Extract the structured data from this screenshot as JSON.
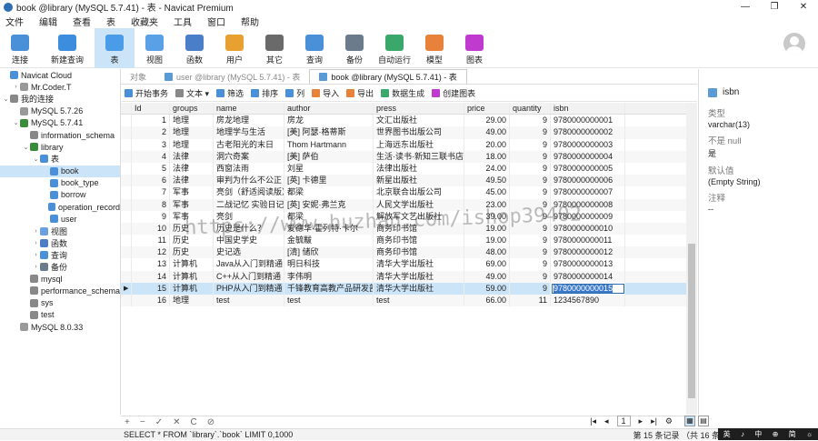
{
  "window": {
    "title": "book @library (MySQL 5.7.41) - 表 - Navicat Premium",
    "controls": [
      "—",
      "❐",
      "✕"
    ]
  },
  "menu": [
    "文件",
    "编辑",
    "查看",
    "表",
    "收藏夹",
    "工具",
    "窗口",
    "帮助"
  ],
  "toolbar": {
    "buttons": [
      {
        "label": "连接",
        "icon": "plug-icon",
        "color": "#4a90d9"
      },
      {
        "label": "新建查询",
        "icon": "query-icon",
        "color": "#3c8dde"
      },
      {
        "label": "表",
        "icon": "table-icon",
        "color": "#4a9be8"
      },
      {
        "label": "视图",
        "icon": "view-icon",
        "color": "#5aa0e6"
      },
      {
        "label": "函数",
        "icon": "function-icon",
        "color": "#4b7ec9"
      },
      {
        "label": "用户",
        "icon": "user-icon",
        "color": "#e8a030"
      },
      {
        "label": "其它",
        "icon": "tools-icon",
        "color": "#6a6a6a"
      },
      {
        "label": "查询",
        "icon": "search-table-icon",
        "color": "#4a90d9"
      },
      {
        "label": "备份",
        "icon": "backup-icon",
        "color": "#6b7b8b"
      },
      {
        "label": "自动运行",
        "icon": "robot-icon",
        "color": "#3aa86b"
      },
      {
        "label": "模型",
        "icon": "model-icon",
        "color": "#e8823a"
      },
      {
        "label": "图表",
        "icon": "chart-icon",
        "color": "#c03ad0"
      }
    ]
  },
  "sidebar": {
    "items": [
      {
        "label": "Navicat Cloud",
        "level": 0,
        "arrow": "",
        "icon": "cloud-icon",
        "color": "#4a90d9"
      },
      {
        "label": "Mr.Coder.T",
        "level": 1,
        "arrow": "›",
        "icon": "cloud-user-icon",
        "color": "#999"
      },
      {
        "label": "我的连接",
        "level": 0,
        "arrow": "⌄",
        "icon": "connections-icon",
        "color": "#888"
      },
      {
        "label": "MySQL 5.7.26",
        "level": 1,
        "arrow": "",
        "icon": "mysql-icon",
        "color": "#999"
      },
      {
        "label": "MySQL 5.7.41",
        "level": 1,
        "arrow": "⌄",
        "icon": "mysql-icon",
        "color": "#3a8b3a"
      },
      {
        "label": "information_schema",
        "level": 2,
        "arrow": "",
        "icon": "database-icon",
        "color": "#888"
      },
      {
        "label": "library",
        "level": 2,
        "arrow": "⌄",
        "icon": "database-icon",
        "color": "#3a8b3a"
      },
      {
        "label": "表",
        "level": 3,
        "arrow": "⌄",
        "icon": "tables-folder-icon",
        "color": "#4a90d9"
      },
      {
        "label": "book",
        "level": 4,
        "arrow": "",
        "icon": "table-icon",
        "color": "#4a90d9",
        "selected": true
      },
      {
        "label": "book_type",
        "level": 4,
        "arrow": "",
        "icon": "table-icon",
        "color": "#4a90d9"
      },
      {
        "label": "borrow",
        "level": 4,
        "arrow": "",
        "icon": "table-icon",
        "color": "#4a90d9"
      },
      {
        "label": "operation_record",
        "level": 4,
        "arrow": "",
        "icon": "table-icon",
        "color": "#4a90d9"
      },
      {
        "label": "user",
        "level": 4,
        "arrow": "",
        "icon": "table-icon",
        "color": "#4a90d9"
      },
      {
        "label": "视图",
        "level": 3,
        "arrow": "›",
        "icon": "views-folder-icon",
        "color": "#6aa0e0"
      },
      {
        "label": "函数",
        "level": 3,
        "arrow": "›",
        "icon": "functions-folder-icon",
        "color": "#4b7ec9"
      },
      {
        "label": "查询",
        "level": 3,
        "arrow": "›",
        "icon": "queries-folder-icon",
        "color": "#4a90d9"
      },
      {
        "label": "备份",
        "level": 3,
        "arrow": "›",
        "icon": "backups-folder-icon",
        "color": "#6b7b8b"
      },
      {
        "label": "mysql",
        "level": 2,
        "arrow": "",
        "icon": "database-icon",
        "color": "#888"
      },
      {
        "label": "performance_schema",
        "level": 2,
        "arrow": "",
        "icon": "database-icon",
        "color": "#888"
      },
      {
        "label": "sys",
        "level": 2,
        "arrow": "",
        "icon": "database-icon",
        "color": "#888"
      },
      {
        "label": "test",
        "level": 2,
        "arrow": "",
        "icon": "database-icon",
        "color": "#888"
      },
      {
        "label": "MySQL 8.0.33",
        "level": 1,
        "arrow": "",
        "icon": "mysql-icon",
        "color": "#999"
      }
    ]
  },
  "tabs": [
    {
      "label": "对象",
      "active": false,
      "icon": false
    },
    {
      "label": "user @library (MySQL 5.7.41) - 表",
      "active": false,
      "icon": true
    },
    {
      "label": "book @library (MySQL 5.7.41) - 表",
      "active": true,
      "icon": true
    }
  ],
  "subtoolbar": [
    {
      "label": "开始事务",
      "icon": "transaction-icon",
      "color": "#4a90d9"
    },
    {
      "label": "文本 ▾",
      "icon": "text-icon",
      "color": "#888"
    },
    {
      "label": "筛选",
      "icon": "filter-icon",
      "color": "#4a90d9"
    },
    {
      "label": "排序",
      "icon": "sort-icon",
      "color": "#4a90d9"
    },
    {
      "label": "列",
      "icon": "columns-icon",
      "color": "#4a90d9"
    },
    {
      "label": "导入",
      "icon": "import-icon",
      "color": "#e8823a"
    },
    {
      "label": "导出",
      "icon": "export-icon",
      "color": "#e8823a"
    },
    {
      "label": "数据生成",
      "icon": "generate-data-icon",
      "color": "#3aa86b"
    },
    {
      "label": "创建图表",
      "icon": "create-chart-icon",
      "color": "#c03ad0"
    }
  ],
  "grid": {
    "columns": [
      "Id",
      "groups",
      "name",
      "author",
      "press",
      "price",
      "quantity",
      "isbn"
    ],
    "rows": [
      [
        "1",
        "地理",
        "房龙地理",
        "房龙",
        "文汇出版社",
        "29.00",
        "9",
        "9780000000001"
      ],
      [
        "2",
        "地理",
        "地理学与生活",
        "[美] 阿瑟·格蒂斯",
        "世界图书出版公司",
        "49.00",
        "9",
        "9780000000002"
      ],
      [
        "3",
        "地理",
        "古老阳光的末日",
        "Thom Hartmann",
        "上海远东出版社",
        "20.00",
        "9",
        "9780000000003"
      ],
      [
        "4",
        "法律",
        "洞穴奇案",
        "[美] 萨伯",
        "生活·读书·新知三联书店",
        "18.00",
        "9",
        "9780000000004"
      ],
      [
        "5",
        "法律",
        "西窗法雨",
        "刘星",
        "法律出版社",
        "24.00",
        "9",
        "9780000000005"
      ],
      [
        "6",
        "法律",
        "审判为什么不公正",
        "[英] 卡德里",
        "新星出版社",
        "49.50",
        "9",
        "9780000000006"
      ],
      [
        "7",
        "军事",
        "亮剑（舒适阅读版）",
        "都梁",
        "北京联合出版公司",
        "45.00",
        "9",
        "9780000000007"
      ],
      [
        "8",
        "军事",
        "二战记忆 实验日记",
        "[英] 安妮·弗兰克",
        "人民文学出版社",
        "23.00",
        "9",
        "9780000000008"
      ],
      [
        "9",
        "军事",
        "亮剑",
        "都梁",
        "解放军文艺出版社",
        "39.00",
        "9",
        "9780000000009"
      ],
      [
        "10",
        "历史",
        "历史是什么？",
        "爱德华·霍列特·卡尔",
        "商务印书馆",
        "19.00",
        "9",
        "9780000000010"
      ],
      [
        "11",
        "历史",
        "中国史学史",
        "金毓黻",
        "商务印书馆",
        "19.00",
        "9",
        "9780000000011"
      ],
      [
        "12",
        "历史",
        "史记选",
        "[清] 储欣",
        "商务印书馆",
        "48.00",
        "9",
        "9780000000012"
      ],
      [
        "13",
        "计算机",
        "Java从入门到精通",
        "明日科技",
        "清华大学出版社",
        "69.00",
        "9",
        "9780000000013"
      ],
      [
        "14",
        "计算机",
        "C++从入门到精通",
        "李伟明",
        "清华大学出版社",
        "49.00",
        "9",
        "9780000000014"
      ],
      [
        "15",
        "计算机",
        "PHP从入门到精通",
        "千锋教育高教产品研发部",
        "清华大学出版社",
        "59.00",
        "9",
        "9780000000015"
      ],
      [
        "16",
        "地理",
        "test",
        "test",
        "test",
        "66.00",
        "11",
        "1234567890"
      ]
    ],
    "current_row_index": 14,
    "focused_cell": {
      "row": 14,
      "col": 7
    },
    "watermark": "https://www.huzhan.com/ishop39402"
  },
  "property_panel": {
    "title": "isbn",
    "fields": [
      {
        "label": "类型",
        "value": "varchar(13)"
      },
      {
        "label": "不是 null",
        "value": "是"
      },
      {
        "label": "默认值",
        "value": "(Empty String)"
      },
      {
        "label": "注释",
        "value": "--"
      }
    ]
  },
  "bottom_tools": [
    "+",
    "−",
    "✓",
    "✕",
    "C",
    "⊘"
  ],
  "pager": {
    "first": "|◂",
    "prev": "◂",
    "page": "1",
    "next": "▸",
    "last": "▸|",
    "settings": "⚙"
  },
  "status": {
    "sql": "SELECT * FROM `library`.`book` LIMIT 0,1000",
    "records": "第 15 条记录 （共 16 条）于第 1 页"
  },
  "taskbar": [
    "英",
    "♪",
    "中",
    "⊕",
    "简",
    "☼"
  ]
}
